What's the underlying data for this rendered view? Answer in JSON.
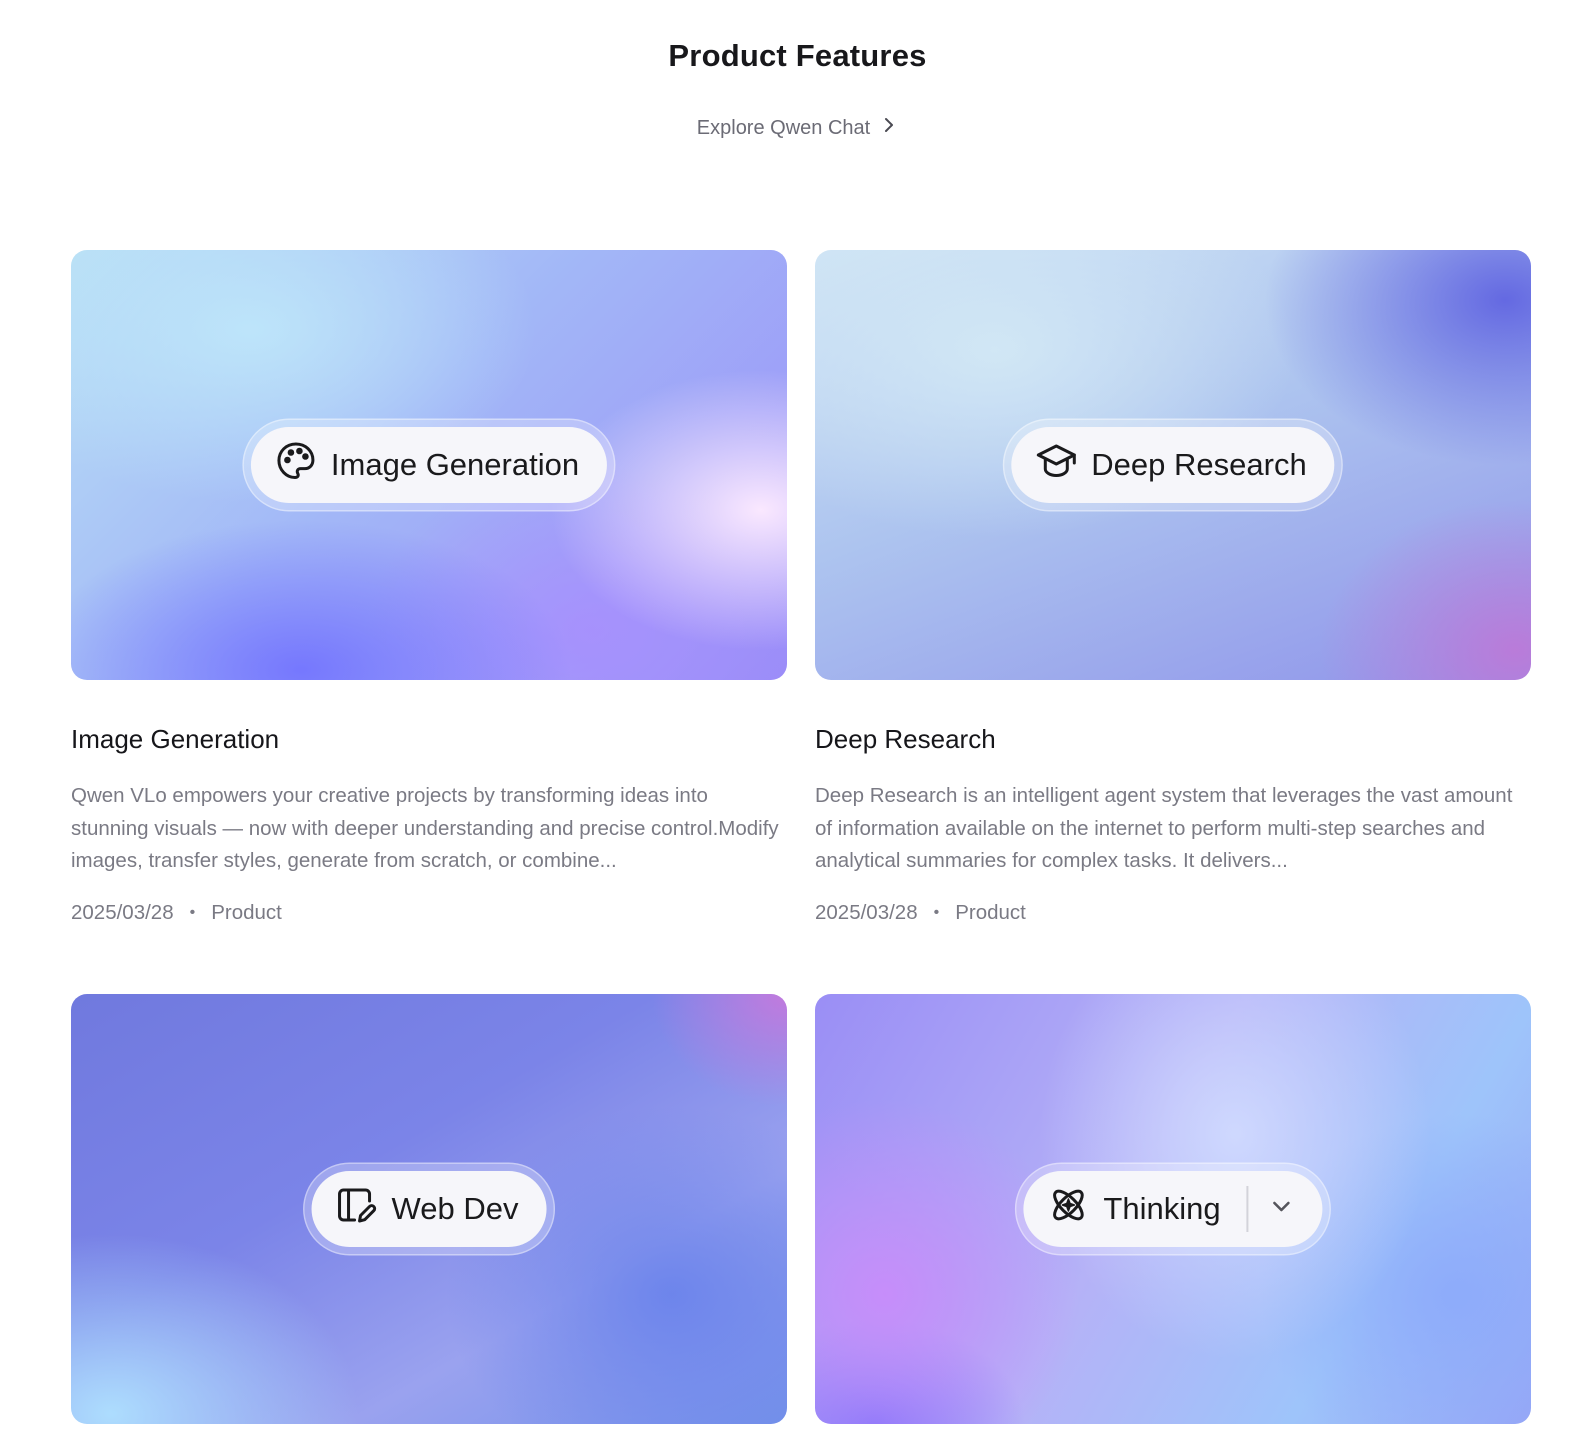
{
  "header": {
    "title": "Product Features",
    "explore_label": "Explore Qwen Chat",
    "explore_icon": "chevron-right-icon"
  },
  "cards": [
    {
      "cover_label": "Image Generation",
      "cover_icon": "palette-icon",
      "title": "Image Generation",
      "description": "Qwen VLo empowers your creative projects by transforming ideas into stunning visuals — now with deeper understanding and precise control.Modify images, transfer styles, generate from scratch, or combine...",
      "date": "2025/03/28",
      "category": "Product"
    },
    {
      "cover_label": "Deep Research",
      "cover_icon": "graduation-cap-icon",
      "title": "Deep Research",
      "description": "Deep Research is an intelligent agent system that leverages the vast amount of information available on the internet to perform multi-step searches and analytical summaries for complex tasks. It delivers...",
      "date": "2025/03/28",
      "category": "Product"
    },
    {
      "cover_label": "Web Dev",
      "cover_icon": "web-dev-edit-icon"
    },
    {
      "cover_label": "Thinking",
      "cover_icon": "atom-sparkle-icon",
      "cover_dropdown_icon": "chevron-down-icon"
    }
  ],
  "meta_separator": "•"
}
